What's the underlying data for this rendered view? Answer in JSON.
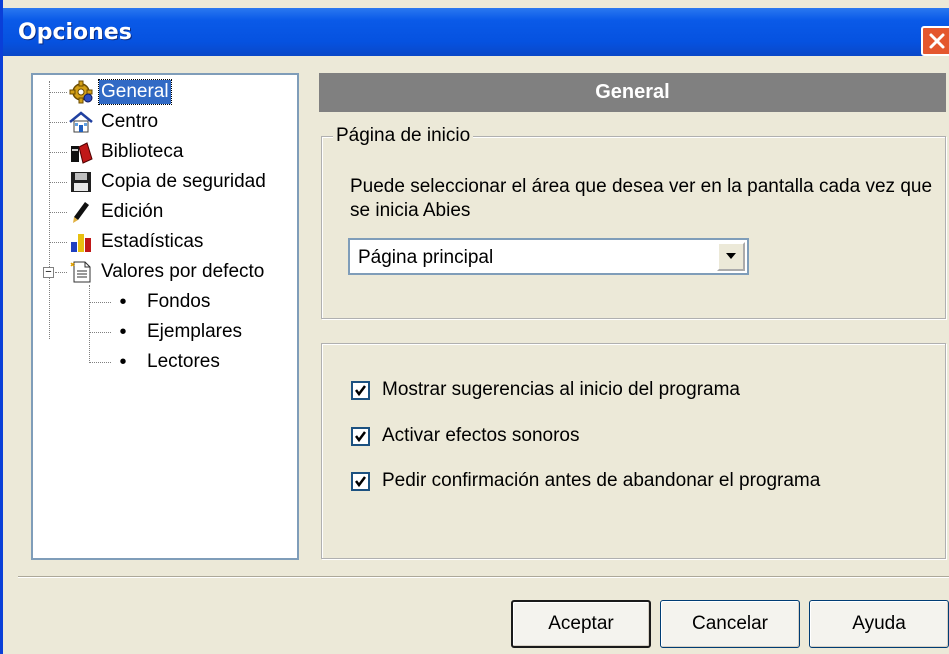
{
  "window": {
    "title": "Opciones"
  },
  "tree": {
    "items": [
      {
        "label": "General",
        "icon": "gear-icon",
        "selected": true
      },
      {
        "label": "Centro",
        "icon": "house-icon"
      },
      {
        "label": "Biblioteca",
        "icon": "books-icon"
      },
      {
        "label": "Copia de seguridad",
        "icon": "floppy-disk-icon"
      },
      {
        "label": "Edición",
        "icon": "pencil-icon"
      },
      {
        "label": "Estadísticas",
        "icon": "bar-chart-icon"
      },
      {
        "label": "Valores por defecto",
        "icon": "document-icon",
        "expanded": true
      }
    ],
    "children": [
      {
        "label": "Fondos"
      },
      {
        "label": "Ejemplares"
      },
      {
        "label": "Lectores"
      }
    ],
    "expander_symbol": "−"
  },
  "panel": {
    "header": "General",
    "start_page_group": {
      "legend": "Página de inicio",
      "description": "Puede seleccionar el área que desea ver en la pantalla cada vez que se inicia Abies",
      "select_value": "Página principal"
    },
    "options": [
      {
        "label": "Mostrar sugerencias al inicio del programa",
        "checked": true
      },
      {
        "label": "Activar efectos sonoros",
        "checked": true
      },
      {
        "label": "Pedir confirmación antes de abandonar el programa",
        "checked": true
      }
    ]
  },
  "buttons": {
    "accept": "Aceptar",
    "cancel": "Cancelar",
    "help": "Ayuda"
  },
  "colors": {
    "titlebar": "#0652e0",
    "selection": "#316ac5",
    "header_bg": "#808080",
    "close_button": "#e4572e"
  }
}
